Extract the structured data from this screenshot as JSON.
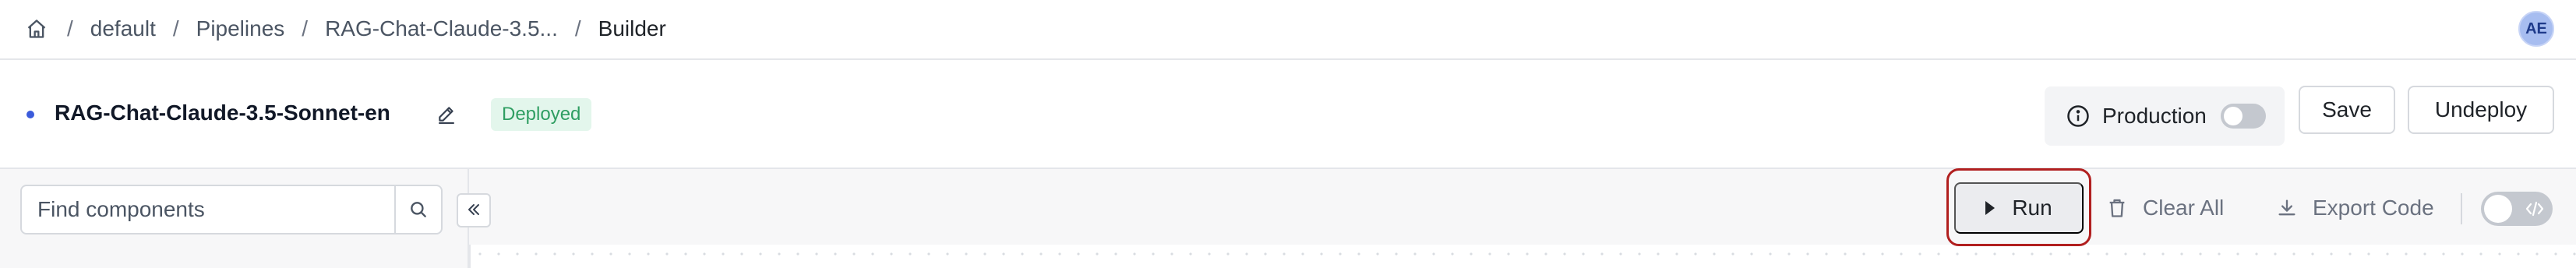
{
  "breadcrumb": {
    "home_icon": "home-icon",
    "separator": "/",
    "items": [
      {
        "label": "default"
      },
      {
        "label": "Pipelines"
      },
      {
        "label": "RAG-Chat-Claude-3.5..."
      },
      {
        "label": "Builder"
      }
    ]
  },
  "user": {
    "initials": "AE"
  },
  "pipeline": {
    "name": "RAG-Chat-Claude-3.5-Sonnet-en",
    "status_badge": "Deployed",
    "edit_icon": "pencil-icon"
  },
  "environment": {
    "label": "Production",
    "info_icon": "info-icon",
    "enabled": false
  },
  "actions": {
    "save_label": "Save",
    "undeploy_label": "Undeploy"
  },
  "toolbar": {
    "search": {
      "placeholder": "Find components",
      "value": ""
    },
    "run_label": "Run",
    "clear_all_label": "Clear All",
    "export_code_label": "Export Code",
    "code_view_enabled": false
  },
  "colors": {
    "accent": "#3b5bdb",
    "deployed_bg": "#e3f6ec",
    "deployed_text": "#2f9e62",
    "highlight_outline": "#b11f1f"
  }
}
